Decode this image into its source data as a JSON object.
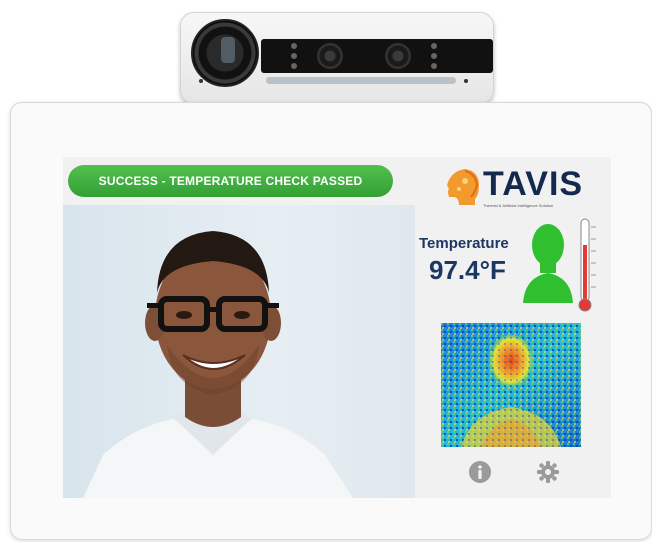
{
  "status": {
    "message": "SUCCESS - TEMPERATURE CHECK PASSED",
    "color": "#3fae3e"
  },
  "brand": {
    "name": "TAVIS",
    "tagline": "Thermal & Artificial Intelligence Solution",
    "color": "#14294e"
  },
  "reading": {
    "label": "Temperature",
    "value": "97.4°F",
    "indicator_color": "#2fbf2f"
  },
  "icons": {
    "info": "info-icon",
    "settings": "gear-icon",
    "subject": "head-silhouette-icon",
    "thermometer": "thermometer-icon"
  }
}
